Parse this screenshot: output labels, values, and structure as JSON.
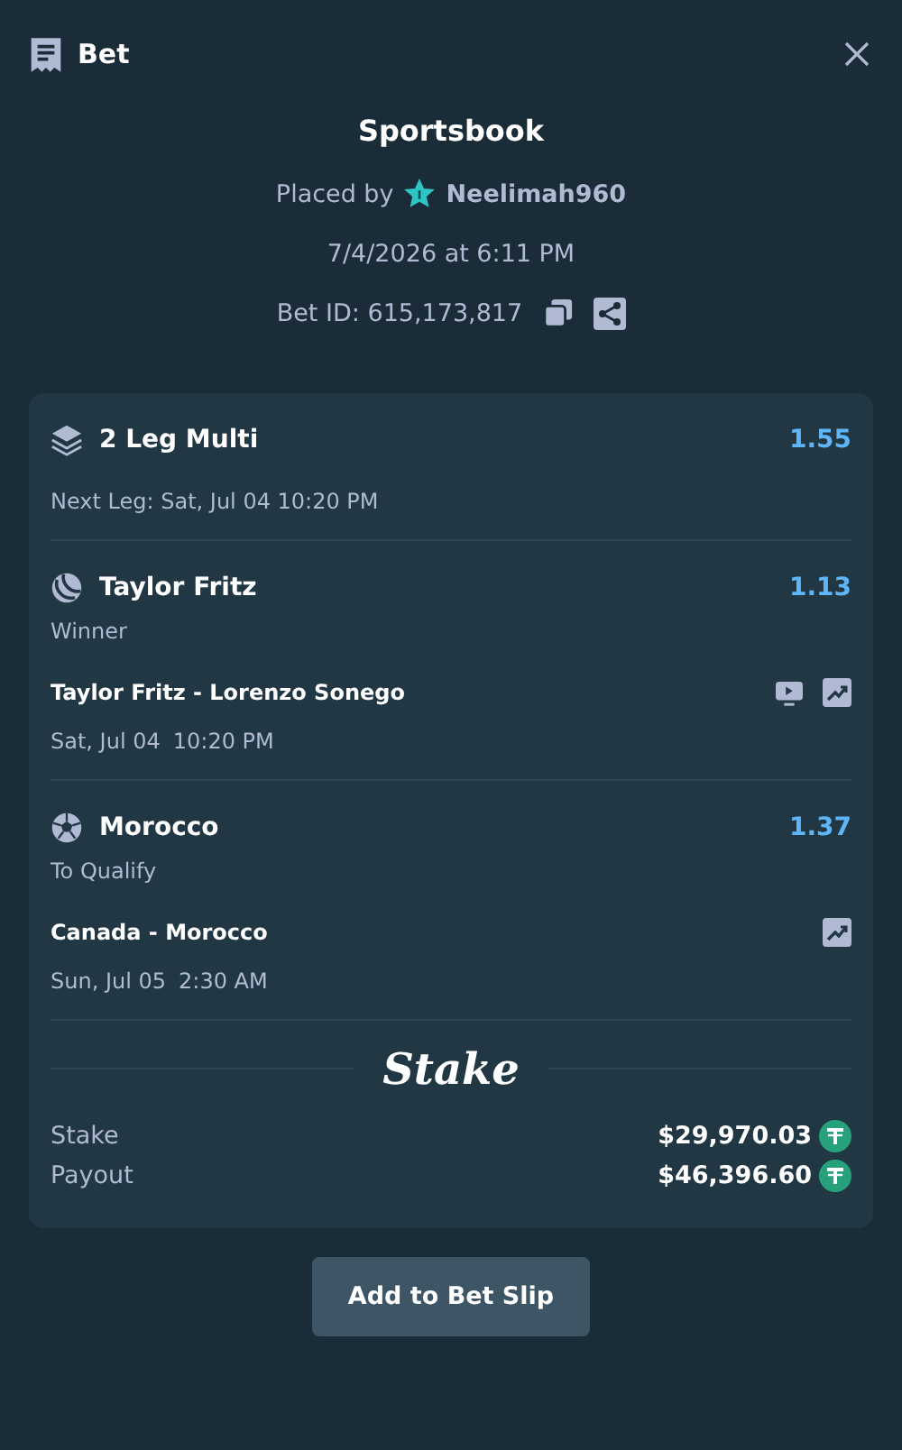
{
  "header": {
    "title": "Bet"
  },
  "summary": {
    "title": "Sportsbook",
    "placed_by_label": "Placed by",
    "user": "Neelimah960",
    "date": "7/4/2026 at 6:11 PM",
    "bet_id": "Bet ID: 615,173,817"
  },
  "multi": {
    "title": "2 Leg Multi",
    "odds": "1.55",
    "next_leg": "Next Leg: Sat, Jul 04 10:20 PM"
  },
  "legs": [
    {
      "kind": "tennis",
      "selection": "Taylor Fritz",
      "odds": "1.13",
      "market": "Winner",
      "event": "Taylor Fritz - Lorenzo Sonego",
      "live_stream": true,
      "date": "Sat, Jul 04",
      "time": "10:20 PM"
    },
    {
      "kind": "soccer",
      "selection": "Morocco",
      "odds": "1.37",
      "market": "To Qualify",
      "event": "Canada - Morocco",
      "live_stream": false,
      "date": "Sun, Jul 05",
      "time": "2:30 AM"
    }
  ],
  "brand": "Stake",
  "totals": [
    {
      "label": "Stake",
      "amount": "$29,970.03"
    },
    {
      "label": "Payout",
      "amount": "$46,396.60"
    }
  ],
  "button": "Add to Bet Slip"
}
